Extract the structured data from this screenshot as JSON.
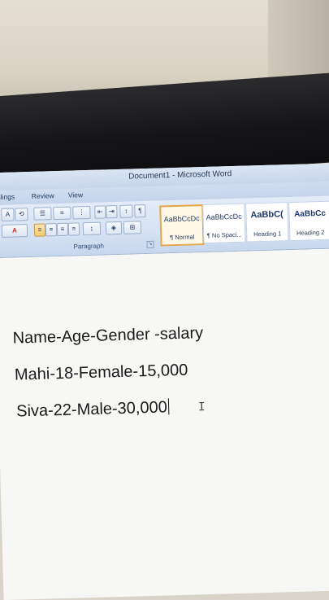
{
  "window": {
    "title": "Document1 - Microsoft Word"
  },
  "ribbon": {
    "tabs": [
      "ilings",
      "Review",
      "View"
    ],
    "paragraph_group_label": "Paragraph",
    "font_color_glyph": "A",
    "styles": [
      {
        "sample": "AaBbCcDc",
        "name": "¶ Normal",
        "selected": true
      },
      {
        "sample": "AaBbCcDc",
        "name": "¶ No Spaci...",
        "selected": false
      },
      {
        "sample": "AaBbC(",
        "name": "Heading 1",
        "selected": false
      },
      {
        "sample": "AaBbCc",
        "name": "Heading 2",
        "selected": false
      }
    ]
  },
  "document": {
    "lines": [
      "Name-Age-Gender -salary",
      "Mahi-18-Female-15,000",
      "Siva-22-Male-30,000"
    ],
    "pointer_glyph": "I"
  },
  "icons": [
    "bullets-icon",
    "numbering-icon",
    "multilevel-list-icon",
    "decrease-indent-icon",
    "increase-indent-icon",
    "sort-icon",
    "show-formatting-icon",
    "align-left-icon",
    "align-center-icon",
    "align-right-icon",
    "justify-icon",
    "line-spacing-icon",
    "shading-icon",
    "borders-icon",
    "font-color-icon",
    "ibeam-cursor-icon"
  ]
}
